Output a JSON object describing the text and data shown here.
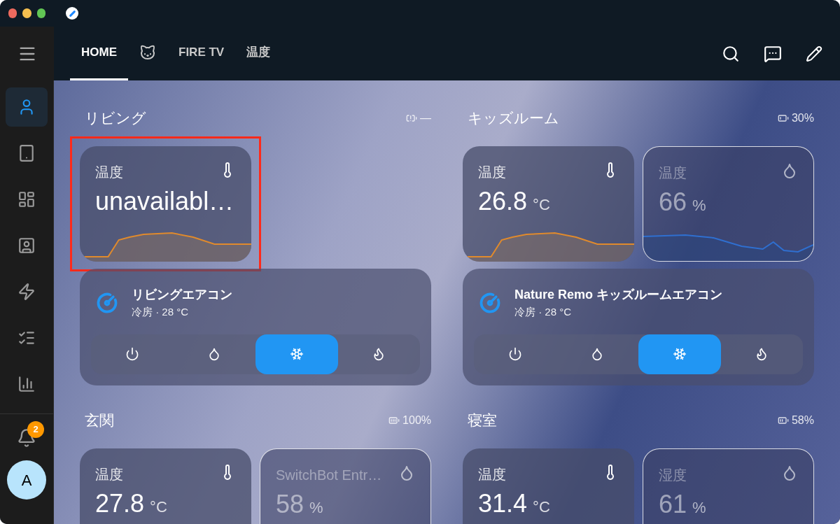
{
  "tabs": [
    {
      "kind": "text",
      "label": "HOME",
      "selected": true
    },
    {
      "kind": "cat",
      "selected": false
    },
    {
      "kind": "text",
      "label": "FIRE TV",
      "selected": false
    },
    {
      "kind": "text",
      "label": "温度",
      "selected": false
    }
  ],
  "sidebar": {
    "items": [
      {
        "kind": "person",
        "selected": true
      },
      {
        "kind": "tablet",
        "selected": false
      },
      {
        "kind": "dashboard",
        "selected": false
      },
      {
        "kind": "contact",
        "selected": false
      },
      {
        "kind": "bolt",
        "selected": false
      },
      {
        "kind": "list",
        "selected": false
      },
      {
        "kind": "chart",
        "selected": false
      }
    ],
    "notification_count": "2",
    "avatar": "A"
  },
  "sections": [
    {
      "title": "リビング",
      "battery": {
        "kind": "unknown",
        "label": "—"
      },
      "sensors": [
        {
          "kind": "temperature",
          "label": "温度",
          "value": "unavailabl…",
          "dimmed": false,
          "outlined": false,
          "highlighted": true
        }
      ],
      "thermostat": {
        "name": "リビングエアコン",
        "state": "冷房 · 28 °C",
        "modes": [
          {
            "kind": "off",
            "selected": false
          },
          {
            "kind": "dry",
            "selected": false
          },
          {
            "kind": "cool",
            "selected": true
          },
          {
            "kind": "heat",
            "selected": false
          }
        ]
      }
    },
    {
      "title": "キッズルーム",
      "battery": {
        "kind": "low",
        "label": "30%"
      },
      "sensors": [
        {
          "kind": "temperature",
          "label": "温度",
          "value": "26.8",
          "unit": "°C",
          "dimmed": false,
          "outlined": false,
          "highlighted": false
        },
        {
          "kind": "humidity",
          "label": "温度",
          "value": "66",
          "unit": "%",
          "dimmed": true,
          "outlined": true,
          "highlighted": false
        }
      ],
      "thermostat": {
        "name": "Nature Remo キッズルームエアコン",
        "state": "冷房 · 28 °C",
        "modes": [
          {
            "kind": "off",
            "selected": false
          },
          {
            "kind": "dry",
            "selected": false
          },
          {
            "kind": "cool",
            "selected": true
          },
          {
            "kind": "heat",
            "selected": false
          }
        ]
      }
    },
    {
      "title": "玄関",
      "battery": {
        "kind": "full",
        "label": "100%"
      },
      "sensors": [
        {
          "kind": "temperature",
          "label": "温度",
          "value": "27.8",
          "unit": "°C",
          "dimmed": false,
          "outlined": false,
          "highlighted": false
        },
        {
          "kind": "humidity",
          "label": "SwitchBot Entr…",
          "value": "58",
          "unit": "%",
          "dimmed": true,
          "outlined": true,
          "highlighted": false
        }
      ]
    },
    {
      "title": "寝室",
      "battery": {
        "kind": "medium",
        "label": "58%"
      },
      "sensors": [
        {
          "kind": "temperature",
          "label": "温度",
          "value": "31.4",
          "unit": "°C",
          "dimmed": false,
          "outlined": false,
          "highlighted": false
        },
        {
          "kind": "humidity",
          "label": "湿度",
          "value": "61",
          "unit": "%",
          "dimmed": true,
          "outlined": true,
          "highlighted": false
        }
      ]
    }
  ]
}
